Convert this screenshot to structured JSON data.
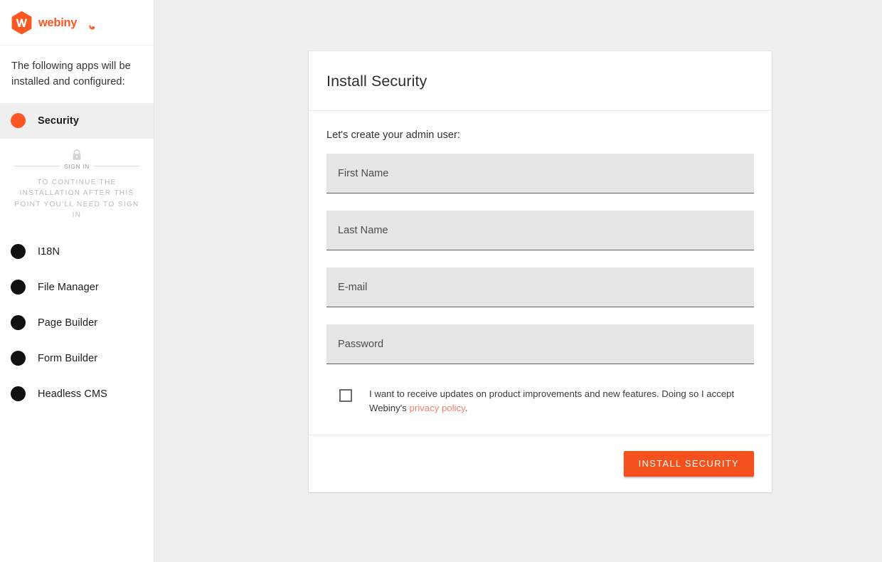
{
  "brand": {
    "logo_icon": "webiny-hexagon-logo",
    "wordmark": "webiny",
    "accent_color": "#fa5723",
    "button_color": "#f4511e",
    "link_color": "#f0816c"
  },
  "sidebar": {
    "intro": "The following apps will be installed and configured:",
    "active_app": {
      "label": "Security",
      "bullet_color": "#fa5723"
    },
    "signin": {
      "icon": "lock-icon",
      "divider_label": "SIGN IN",
      "note": "TO CONTINUE THE INSTALLATION AFTER THIS POINT YOU'LL NEED TO SIGN IN"
    },
    "apps": [
      {
        "label": "I18N",
        "bullet_color": "#111111"
      },
      {
        "label": "File Manager",
        "bullet_color": "#111111"
      },
      {
        "label": "Page Builder",
        "bullet_color": "#111111"
      },
      {
        "label": "Form Builder",
        "bullet_color": "#111111"
      },
      {
        "label": "Headless CMS",
        "bullet_color": "#111111"
      }
    ]
  },
  "card": {
    "title": "Install Security",
    "lead": "Let's create your admin user:",
    "fields": [
      {
        "label": "First Name",
        "value": "",
        "type": "text"
      },
      {
        "label": "Last Name",
        "value": "",
        "type": "text"
      },
      {
        "label": "E-mail",
        "value": "",
        "type": "email"
      },
      {
        "label": "Password",
        "value": "",
        "type": "password"
      }
    ],
    "consent": {
      "checked": false,
      "text_before": "I want to receive updates on product improvements and new features. Doing so I accept Webiny's ",
      "link_text": "privacy policy",
      "text_after": "."
    },
    "submit_label": "INSTALL SECURITY"
  }
}
